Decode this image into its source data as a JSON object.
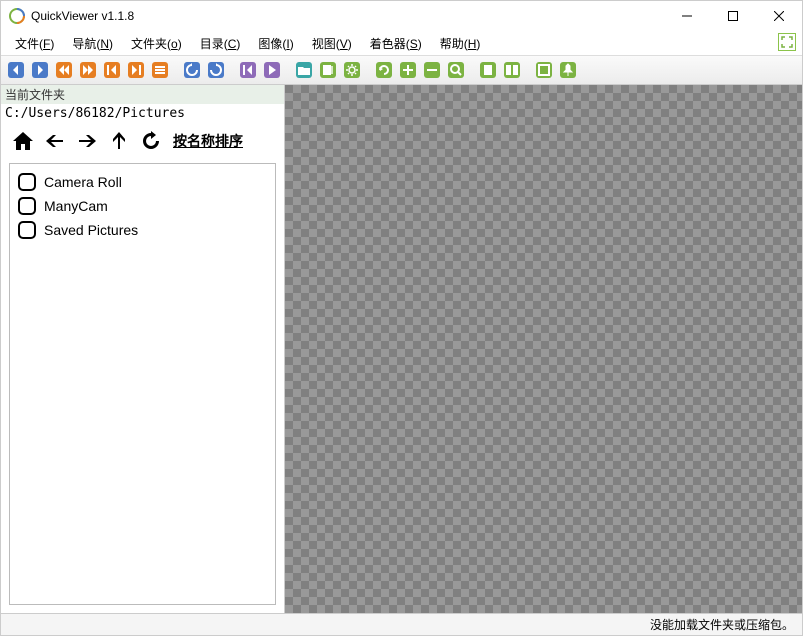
{
  "window": {
    "title": "QuickViewer v1.1.8"
  },
  "menu": {
    "file": "文件(",
    "file_u": "F",
    "file_end": ")",
    "nav": "导航(",
    "nav_u": "N",
    "nav_end": ")",
    "folder": "文件夹(",
    "folder_u": "o",
    "folder_end": ")",
    "catalog": "目录(",
    "catalog_u": "C",
    "catalog_end": ")",
    "image": "图像(",
    "image_u": "I",
    "image_end": ")",
    "view": "视图(",
    "view_u": "V",
    "view_end": ")",
    "shader": "着色器(",
    "shader_u": "S",
    "shader_end": ")",
    "help": "帮助(",
    "help_u": "H",
    "help_end": ")"
  },
  "sidebar": {
    "panel_label": "当前文件夹",
    "path": "C:/Users/86182/Pictures",
    "sort_label": "按名称排序",
    "folders": [
      {
        "name": "Camera Roll"
      },
      {
        "name": "ManyCam"
      },
      {
        "name": "Saved Pictures"
      }
    ]
  },
  "status": {
    "message": "没能加载文件夹或压缩包。"
  },
  "colors": {
    "blue": "#4a7ac8",
    "orange": "#e67e22",
    "purple": "#8e6bb8",
    "green": "#7cb342",
    "teal": "#3aa6a6"
  }
}
